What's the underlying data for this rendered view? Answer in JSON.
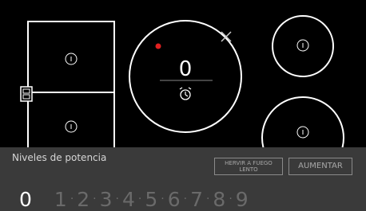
{
  "cooktop": {
    "center_zone": {
      "power_value": "0"
    }
  },
  "panel": {
    "title": "Niveles de potencia",
    "buttons": {
      "simmer_line1": "HERVIR A FUEGO",
      "simmer_line2": "LENTO",
      "increase": "AUMENTAR"
    },
    "levels": [
      "0",
      "1",
      "2",
      "3",
      "4",
      "5",
      "6",
      "7",
      "8",
      "9"
    ],
    "selected_level": "0",
    "separator": "·"
  },
  "colors": {
    "zone_outline": "#ffffff",
    "active_indicator": "#e02020",
    "panel_background": "#3a3a3a"
  }
}
